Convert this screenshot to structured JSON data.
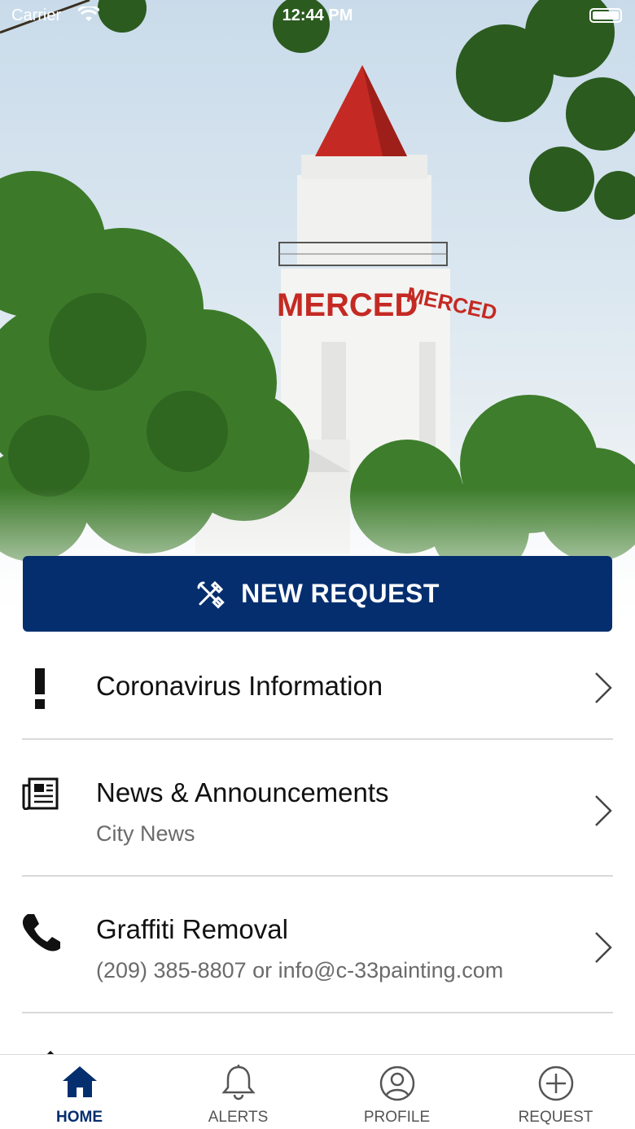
{
  "status_bar": {
    "carrier": "Carrier",
    "time": "12:44 PM"
  },
  "hero": {
    "tower_sign": "MERCED",
    "tower_sign_side": "MERCED"
  },
  "new_request": {
    "label": "NEW REQUEST",
    "icon": "tools-icon",
    "color": "#052e6f"
  },
  "list": {
    "items": [
      {
        "title": "Coronavirus Information",
        "subtitle": "",
        "icon": "exclamation-icon"
      },
      {
        "title": "News & Announcements",
        "subtitle": "City News",
        "icon": "newspaper-icon"
      },
      {
        "title": "Graffiti Removal",
        "subtitle": "(209) 385-8807 or info@c-33painting.com",
        "icon": "phone-icon"
      }
    ]
  },
  "tab_bar": {
    "active_color": "#052e6f",
    "tabs": [
      {
        "label": "HOME",
        "icon": "home-icon",
        "active": true
      },
      {
        "label": "ALERTS",
        "icon": "bell-icon",
        "active": false
      },
      {
        "label": "PROFILE",
        "icon": "user-circle-icon",
        "active": false
      },
      {
        "label": "REQUEST",
        "icon": "plus-circle-icon",
        "active": false
      }
    ]
  }
}
